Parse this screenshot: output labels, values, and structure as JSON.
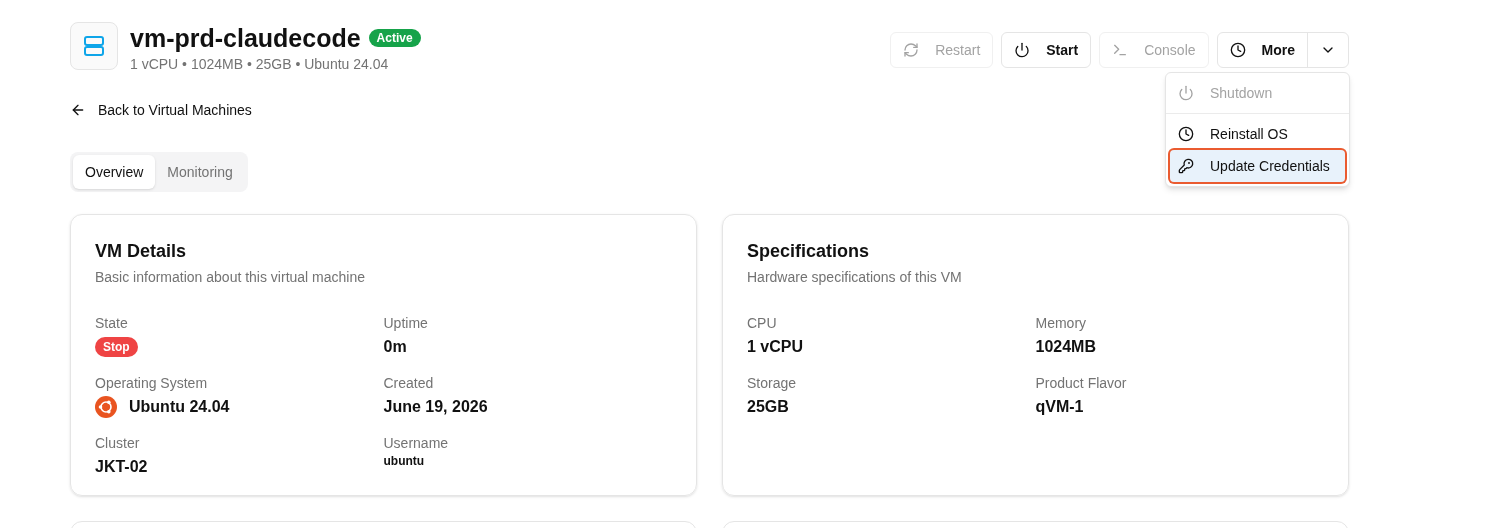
{
  "header": {
    "title": "vm-prd-claudecode",
    "status": "Active",
    "subtitle": "1 vCPU • 1024MB • 25GB • Ubuntu 24.04"
  },
  "actions": [
    {
      "kind": "restart",
      "label": "Restart",
      "disabled": true
    },
    {
      "kind": "power",
      "label": "Start",
      "disabled": false
    },
    {
      "kind": "console",
      "label": "Console",
      "disabled": true
    },
    {
      "kind": "more",
      "label": "More",
      "disabled": false
    }
  ],
  "menu": {
    "items": [
      {
        "kind": "power",
        "label": "Shutdown",
        "disabled": true,
        "selected": false
      },
      {
        "kind": "clock",
        "label": "Reinstall OS",
        "disabled": false,
        "selected": false
      },
      {
        "kind": "key",
        "label": "Update Credentials",
        "disabled": false,
        "selected": true
      }
    ]
  },
  "back_link": "Back to Virtual Machines",
  "tabs": [
    {
      "label": "Overview",
      "selected": true
    },
    {
      "label": "Monitoring",
      "selected": false
    }
  ],
  "cards": [
    {
      "title": "VM Details",
      "description": "Basic information about this virtual machine",
      "fields": [
        {
          "kind": "badge",
          "label": "State",
          "value": "Stop"
        },
        {
          "kind": "text",
          "label": "Uptime",
          "value": "0m"
        },
        {
          "kind": "os",
          "label": "Operating System",
          "value": "Ubuntu 24.04"
        },
        {
          "kind": "text",
          "label": "Created",
          "value": "June 19, 2026"
        },
        {
          "kind": "text",
          "label": "Cluster",
          "value": "JKT-02"
        },
        {
          "kind": "small",
          "label": "Username",
          "value": "ubuntu"
        }
      ]
    },
    {
      "title": "Specifications",
      "description": "Hardware specifications of this VM",
      "fields": [
        {
          "kind": "text",
          "label": "CPU",
          "value": "1 vCPU"
        },
        {
          "kind": "text",
          "label": "Memory",
          "value": "1024MB"
        },
        {
          "kind": "text",
          "label": "Storage",
          "value": "25GB"
        },
        {
          "kind": "text",
          "label": "Product Flavor",
          "value": "qVM-1"
        }
      ]
    }
  ]
}
